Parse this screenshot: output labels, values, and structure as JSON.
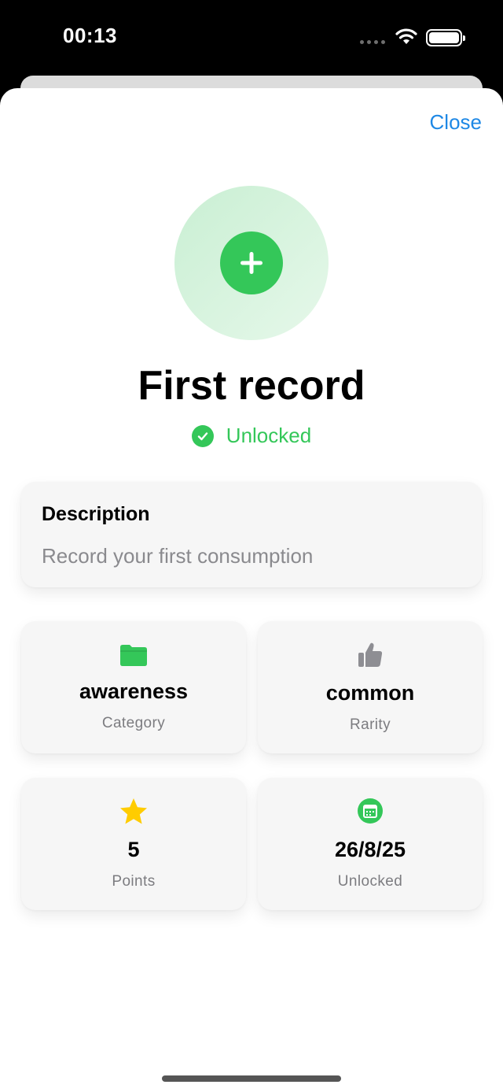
{
  "status_bar": {
    "time": "00:13"
  },
  "header": {
    "close_label": "Close"
  },
  "achievement": {
    "icon": "plus-icon",
    "title": "First record",
    "status": "Unlocked",
    "accent_color": "#34C759"
  },
  "description": {
    "heading": "Description",
    "text": "Record your first consumption"
  },
  "stats": [
    {
      "icon": "folder-icon",
      "value": "awareness",
      "label": "Category"
    },
    {
      "icon": "thumbs-up-icon",
      "value": "common",
      "label": "Rarity"
    },
    {
      "icon": "star-icon",
      "value": "5",
      "label": "Points"
    },
    {
      "icon": "calendar-icon",
      "value": "26/8/25",
      "label": "Unlocked"
    }
  ],
  "colors": {
    "link": "#1E88E5",
    "accent": "#34C759",
    "star": "#FFCC00",
    "muted": "#8A8A8E"
  }
}
